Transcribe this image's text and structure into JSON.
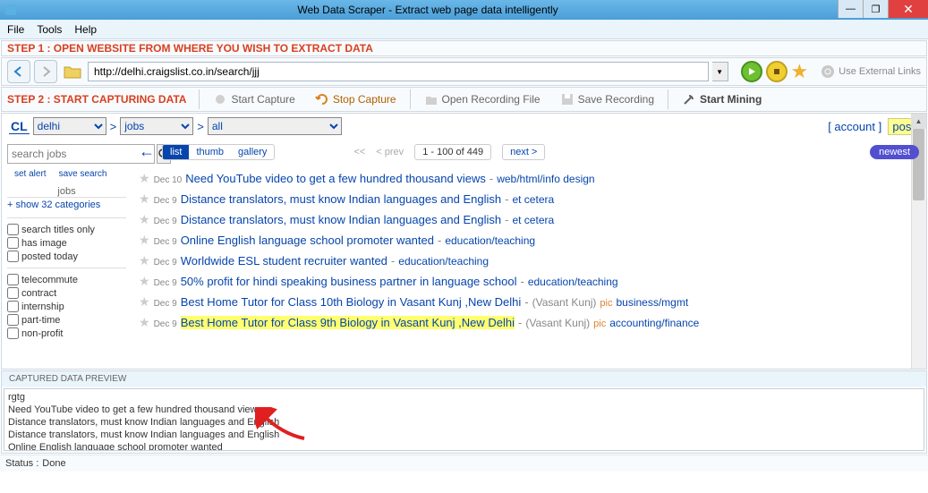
{
  "window": {
    "title": "Web Data Scraper -  Extract web page data intelligently"
  },
  "menu": {
    "file": "File",
    "tools": "Tools",
    "help": "Help"
  },
  "step1": {
    "label": "STEP 1 : OPEN WEBSITE FROM WHERE YOU WISH TO EXTRACT DATA",
    "url": "http://delhi.craigslist.co.in/search/jjj",
    "ext_links": "Use External Links"
  },
  "step2": {
    "label": "STEP 2 : START CAPTURING DATA",
    "start_capture": "Start Capture",
    "stop_capture": "Stop Capture",
    "open_recording": "Open Recording File",
    "save_recording": "Save Recording",
    "start_mining": "Start Mining"
  },
  "cl": {
    "logo": "CL",
    "sel_city": "delhi",
    "sel_cat": "jobs",
    "sel_sub": "all",
    "account": "account",
    "post": "post",
    "search_placeholder": "search jobs",
    "set_alert": "set alert",
    "save_search": "save search",
    "side_head": "jobs",
    "show_cats": "+ show 32 categories",
    "filters1": [
      "search titles only",
      "has image",
      "posted today"
    ],
    "filters2": [
      "telecommute",
      "contract",
      "internship",
      "part-time",
      "non-profit"
    ],
    "view_list": "list",
    "view_thumb": "thumb",
    "view_gallery": "gallery",
    "pg_first": "<<",
    "pg_prev": "< prev",
    "pg_info": "1 - 100 of 449",
    "pg_next": "next >",
    "newest": "newest",
    "listings": [
      {
        "date": "Dec 10",
        "title": "Need YouTube video to get a few hundred thousand views",
        "loc": "",
        "pic": false,
        "cat": "web/html/info design",
        "hl": false
      },
      {
        "date": "Dec 9",
        "title": "Distance translators, must know Indian languages and English",
        "loc": "",
        "pic": false,
        "cat": "et cetera",
        "hl": false
      },
      {
        "date": "Dec 9",
        "title": "Distance translators, must know Indian languages and English",
        "loc": "",
        "pic": false,
        "cat": "et cetera",
        "hl": false
      },
      {
        "date": "Dec 9",
        "title": "Online English language school promoter wanted",
        "loc": "",
        "pic": false,
        "cat": "education/teaching",
        "hl": false
      },
      {
        "date": "Dec 9",
        "title": "Worldwide ESL student recruiter wanted",
        "loc": "",
        "pic": false,
        "cat": "education/teaching",
        "hl": false
      },
      {
        "date": "Dec 9",
        "title": "50% profit for hindi speaking business partner in language school",
        "loc": "",
        "pic": false,
        "cat": "education/teaching",
        "hl": false
      },
      {
        "date": "Dec 9",
        "title": "Best Home Tutor for Class 10th Biology in Vasant Kunj ,New Delhi",
        "loc": "(Vasant Kunj)",
        "pic": true,
        "cat": "business/mgmt",
        "hl": false
      },
      {
        "date": "Dec 9",
        "title": "Best Home Tutor for Class 9th Biology in Vasant Kunj ,New Delhi",
        "loc": "(Vasant Kunj)",
        "pic": true,
        "cat": "accounting/finance",
        "hl": true
      }
    ]
  },
  "preview": {
    "head": "CAPTURED DATA PREVIEW",
    "lines": [
      "rgtg",
      "Need YouTube video to get a few hundred thousand views",
      "Distance translators, must know Indian languages and English",
      "Distance translators, must know Indian languages and English",
      "Online English language school promoter wanted"
    ]
  },
  "status": {
    "label": "Status :",
    "value": "Done"
  }
}
